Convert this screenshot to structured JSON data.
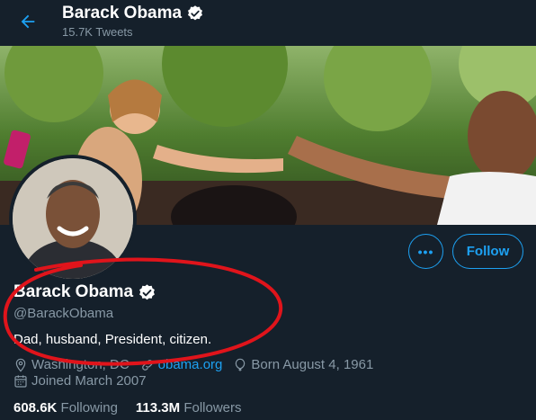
{
  "header": {
    "name": "Barack Obama",
    "tweets_count": "15.7K Tweets"
  },
  "profile": {
    "name": "Barack Obama",
    "handle": "@BarackObama",
    "bio": "Dad, husband, President, citizen.",
    "location": "Washington, DC",
    "website": "obama.org",
    "birthday": "Born August 4, 1961",
    "joined": "Joined March 2007",
    "following_count": "608.6K",
    "following_label": "Following",
    "followers_count": "113.3M",
    "followers_label": "Followers"
  },
  "actions": {
    "more": "•••",
    "follow": "Follow"
  },
  "icons": {
    "back": "arrow-left-icon",
    "verified": "verified-badge-icon",
    "location": "location-pin-icon",
    "link": "link-icon",
    "birthday": "balloon-icon",
    "calendar": "calendar-icon"
  },
  "colors": {
    "background": "#15202b",
    "accent": "#1da1f2",
    "muted": "#8899a6",
    "annotation": "#e0141b"
  }
}
